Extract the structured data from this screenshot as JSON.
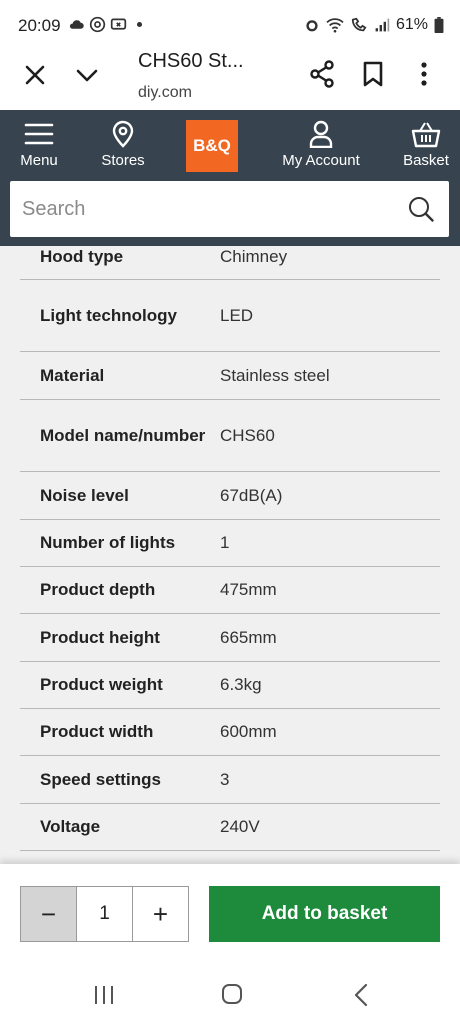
{
  "status_bar": {
    "time": "20:09",
    "battery": "61%",
    "icons": [
      "cloud-icon",
      "at-icon",
      "screen-record-icon",
      "dot-icon",
      "alarm-icon",
      "wifi-icon",
      "call-icon",
      "signal-icon",
      "battery-icon"
    ]
  },
  "browser": {
    "title": "CHS60 St...",
    "url": "diy.com",
    "icons": [
      "close-icon",
      "chevron-down-icon",
      "share-icon",
      "bookmark-icon",
      "more-icon"
    ]
  },
  "header": {
    "menu_label": "Menu",
    "stores_label": "Stores",
    "logo_text": "B&Q",
    "account_label": "My Account",
    "basket_label": "Basket",
    "search_placeholder": "Search",
    "bg_color": "#37444f",
    "logo_color": "#f26722"
  },
  "specs": [
    {
      "label": "Hood type",
      "value": "Chimney"
    },
    {
      "label": "Light technology",
      "value": "LED"
    },
    {
      "label": "Material",
      "value": "Stainless steel"
    },
    {
      "label": "Model name/number",
      "value": "CHS60"
    },
    {
      "label": "Noise level",
      "value": "67dB(A)"
    },
    {
      "label": "Number of lights",
      "value": "1"
    },
    {
      "label": "Product depth",
      "value": "475mm"
    },
    {
      "label": "Product height",
      "value": "665mm"
    },
    {
      "label": "Product weight",
      "value": "6.3kg"
    },
    {
      "label": "Product width",
      "value": "600mm"
    },
    {
      "label": "Speed settings",
      "value": "3"
    },
    {
      "label": "Voltage",
      "value": "240V"
    }
  ],
  "action_bar": {
    "minus": "−",
    "quantity": "1",
    "plus": "+",
    "add_label": "Add to basket",
    "add_color": "#1e8b3c"
  }
}
